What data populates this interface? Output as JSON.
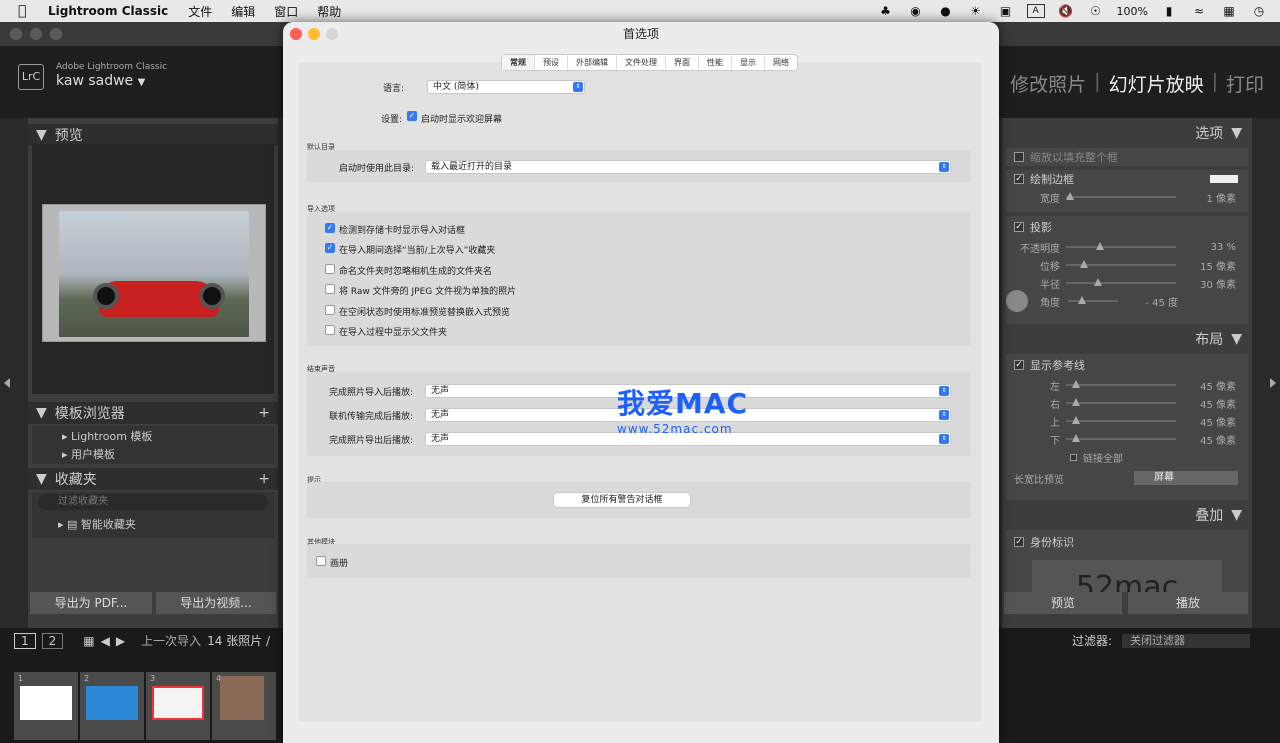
{
  "menubar": {
    "app": "Lightroom Classic",
    "menus": [
      "文件",
      "编辑",
      "窗口",
      "帮助"
    ],
    "battery": "100%"
  },
  "lr": {
    "product": "Adobe Lightroom Classic",
    "user": "kaw sadwe",
    "modules": [
      "修改照片",
      "幻灯片放映",
      "打印"
    ],
    "left": {
      "preview": "预览",
      "templates": "模板浏览器",
      "template_items": [
        "Lightroom 模板",
        "用户模板"
      ],
      "collections": "收藏夹",
      "filter_placeholder": "过滤收藏夹",
      "smart_collection": "智能收藏夹",
      "export_pdf": "导出为 PDF...",
      "export_video": "导出为视频..."
    },
    "right": {
      "options": "选项",
      "zoom_fill": "缩放以填充整个框",
      "stroke": "绘制边框",
      "width_label": "宽度",
      "width_val": "1",
      "unit_px": "像素",
      "shadow": "投影",
      "opacity_label": "不透明度",
      "opacity_val": "33",
      "opacity_unit": "%",
      "offset_label": "位移",
      "offset_val": "15",
      "radius_label": "半径",
      "radius_val": "30",
      "angle_label": "角度",
      "angle_val": "- 45",
      "angle_unit": "度",
      "layout": "布局",
      "show_guides": "显示参考线",
      "left_label": "左",
      "right_label": "右",
      "top_label": "上",
      "bottom_label": "下",
      "margin_val": "45",
      "link_all": "链接全部",
      "aspect_label": "长宽比预览",
      "aspect_val": "屏幕",
      "overlay": "叠加",
      "identity_plate": "身份标识",
      "plate_text": "52mac",
      "preview_btn": "预览",
      "play_btn": "播放"
    },
    "filmbar": {
      "page1": "1",
      "page2": "2",
      "source": "上一次导入",
      "count": "14 张照片 /",
      "filter_label": "过滤器:",
      "filter_val": "关闭过滤器"
    },
    "thumbs": [
      "1",
      "2",
      "3",
      "4"
    ]
  },
  "dialog": {
    "title": "首选项",
    "tabs": [
      "常规",
      "预设",
      "外部编辑",
      "文件处理",
      "界面",
      "性能",
      "显示",
      "网络"
    ],
    "language_label": "语言:",
    "language_val": "中文 (简体)",
    "settings_label": "设置:",
    "welcome": "启动时显示欢迎屏幕",
    "default_catalog": "默认目录",
    "catalog_label": "启动时使用此目录:",
    "catalog_val": "载入最近打开的目录",
    "import_options": "导入选项",
    "import_items": [
      "检测到存储卡时显示导入对话框",
      "在导入期间选择“当前/上次导入”收藏夹",
      "命名文件夹时忽略相机生成的文件夹名",
      "将 Raw 文件旁的 JPEG 文件视为单独的照片",
      "在空闲状态时使用标准预览替换嵌入式预览",
      "在导入过程中显示父文件夹"
    ],
    "import_checked": [
      true,
      true,
      false,
      false,
      false,
      false
    ],
    "sounds": "结束声音",
    "sound_rows": [
      {
        "label": "完成照片导入后播放:",
        "val": "无声"
      },
      {
        "label": "联机传输完成后播放:",
        "val": "无声"
      },
      {
        "label": "完成照片导出后播放:",
        "val": "无声"
      }
    ],
    "tips": "提示",
    "reset_btn": "复位所有警告对话框",
    "other": "其他模块",
    "book": "画册"
  },
  "watermark": {
    "line1": "我爱MAC",
    "line2": "www.52mac.com"
  }
}
